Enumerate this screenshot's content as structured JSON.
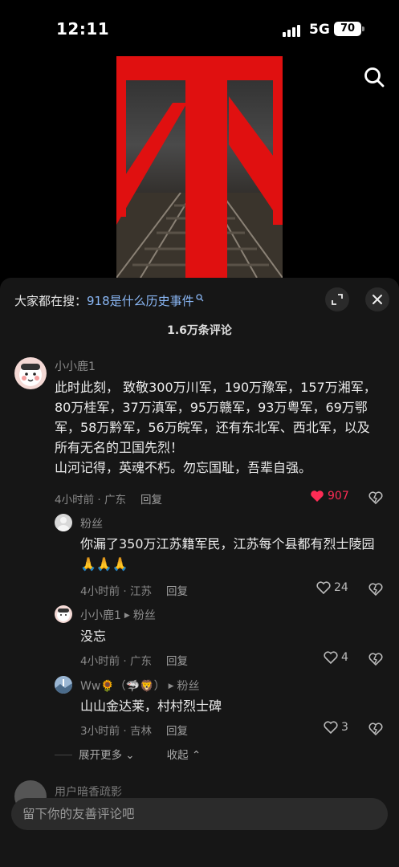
{
  "status": {
    "time": "12:11",
    "network": "5G",
    "battery": "70"
  },
  "panel": {
    "hot_search_prefix": "大家都在搜：",
    "hot_search_query": "918是什么历史事件",
    "comment_count": "1.6万条评论"
  },
  "comments": [
    {
      "user": "小小鹿1",
      "lines": [
        "此时此刻， 致敬300万川军，190万豫军，157万湘军，",
        "80万桂军，37万滇军，95万赣军，93万粤军，69万鄂",
        "军，58万黔军，56万皖军，还有东北军、西北军，以及",
        "所有无名的卫国先烈！",
        "山河记得，英魂不朽。勿忘国耻，吾辈自强。"
      ],
      "time": "4小时前 · 广东",
      "reply": "回复",
      "likes": "907"
    },
    {
      "user": "粉丝",
      "lines": [
        "你漏了350万江苏籍军民，江苏每个县都有烈士陵园",
        "🙏🙏🙏"
      ],
      "time": "4小时前 · 江苏",
      "reply": "回复",
      "likes": "24"
    },
    {
      "user": "小小鹿1",
      "reply_to": "粉丝",
      "lines": [
        "没忘"
      ],
      "time": "4小时前 · 广东",
      "reply": "回复",
      "likes": "4"
    },
    {
      "user": "Ww🌻（🦈🦁）",
      "reply_to": "粉丝",
      "lines": [
        "山山金达莱，村村烈士碑"
      ],
      "time": "3小时前 · 吉林",
      "reply": "回复",
      "likes": "3"
    }
  ],
  "expand": {
    "more": "展开更多",
    "collapse": "收起"
  },
  "next_comment_user": "用户暗香疏影",
  "input": {
    "placeholder": "留下你的友善评论吧"
  },
  "colors": {
    "accent_red": "#e01010",
    "link_blue": "#8ab7f5",
    "like_red": "#fe2c55"
  }
}
